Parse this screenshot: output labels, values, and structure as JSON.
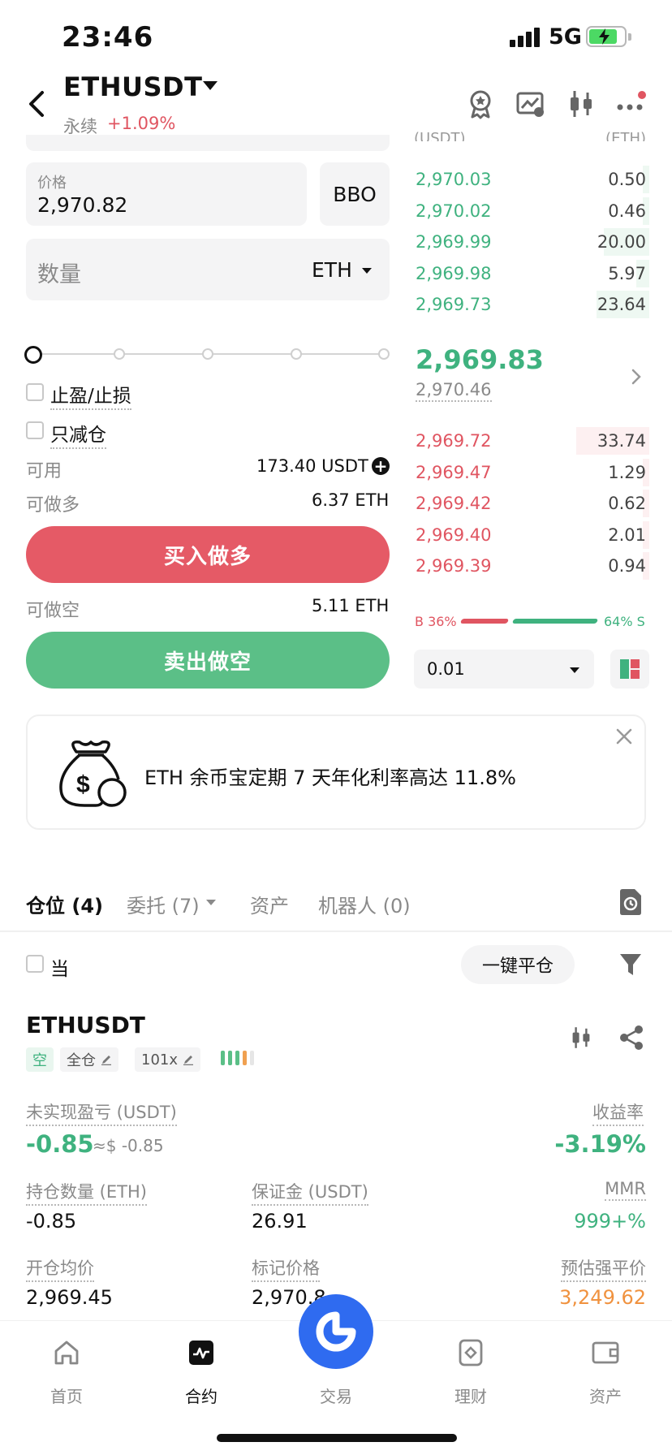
{
  "status_bar": {
    "time": "23:46",
    "network": "5G"
  },
  "header": {
    "pair": "ETHUSDT",
    "contract_type": "永续",
    "change": "+1.09%"
  },
  "order_form": {
    "price_label": "价格",
    "price_value": "2,970.82",
    "bbo_label": "BBO",
    "quantity_placeholder": "数量",
    "quantity_unit": "ETH",
    "slider_percent": 0,
    "tpsl_label": "止盈/止损",
    "reduce_only_label": "只减仓",
    "available_label": "可用",
    "available_value": "173.40 USDT",
    "long_max_label": "可做多",
    "long_max_value": "6.37 ETH",
    "buy_label": "买入做多",
    "short_max_label": "可做空",
    "short_max_value": "5.11 ETH",
    "sell_label": "卖出做空"
  },
  "order_book": {
    "header_price": "(USDT)",
    "header_qty": "(ETH)",
    "asks": [
      {
        "price": "2,970.03",
        "qty": "0.50",
        "depth": 0.02
      },
      {
        "price": "2,970.02",
        "qty": "0.46",
        "depth": 0.02
      },
      {
        "price": "2,969.99",
        "qty": "20.00",
        "depth": 0.62
      },
      {
        "price": "2,969.98",
        "qty": "5.97",
        "depth": 0.18
      },
      {
        "price": "2,969.73",
        "qty": "23.64",
        "depth": 0.72
      }
    ],
    "last_price": "2,969.83",
    "mark_price": "2,970.46",
    "bids": [
      {
        "price": "2,969.72",
        "qty": "33.74",
        "depth": 1.0
      },
      {
        "price": "2,969.47",
        "qty": "1.29",
        "depth": 0.04
      },
      {
        "price": "2,969.42",
        "qty": "0.62",
        "depth": 0.02
      },
      {
        "price": "2,969.40",
        "qty": "2.01",
        "depth": 0.06
      },
      {
        "price": "2,969.39",
        "qty": "0.94",
        "depth": 0.03
      }
    ],
    "buy_ratio_label": "B 36%",
    "sell_ratio_label": "64% S",
    "buy_ratio": 0.36,
    "precision": "0.01"
  },
  "banner": {
    "text": "ETH 余币宝定期 7 天年化利率高达 11.8%"
  },
  "tabs": {
    "positions": "仓位 (4)",
    "orders": "委托 (7)",
    "assets": "资产",
    "bots": "机器人 (0)"
  },
  "position_controls": {
    "current_label": "当",
    "close_all_label": "一键平仓"
  },
  "position": {
    "symbol": "ETHUSDT",
    "side_tag": "空",
    "margin_tag": "全仓",
    "leverage_tag": "101x",
    "upnl_label": "未实现盈亏 (USDT)",
    "upnl_value": "-0.85",
    "upnl_usd": "≈$ -0.85",
    "roe_label": "收益率",
    "roe_value": "-3.19%",
    "qty_label": "持仓数量 (ETH)",
    "qty_value": "-0.85",
    "margin_label": "保证金 (USDT)",
    "margin_value": "26.91",
    "mmr_label": "MMR",
    "mmr_value": "999+%",
    "entry_label": "开仓均价",
    "entry_value": "2,969.45",
    "mark_label": "标记价格",
    "mark_value": "2,970.8",
    "liq_label": "预估强平价",
    "liq_value": "3,249.62"
  },
  "bottom_nav": [
    {
      "label": "首页",
      "icon": "home-icon"
    },
    {
      "label": "合约",
      "icon": "contract-chart-icon"
    },
    {
      "label": "交易",
      "icon": "trade-logo-icon"
    },
    {
      "label": "理财",
      "icon": "finance-icon"
    },
    {
      "label": "资产",
      "icon": "wallet-icon"
    }
  ],
  "colors": {
    "green": "#3fb27f",
    "red": "#e05561",
    "buy_button": "#e55a66",
    "sell_button": "#5bbf87",
    "accent_blue": "#2f6bf0",
    "liq_orange": "#f0923f"
  }
}
